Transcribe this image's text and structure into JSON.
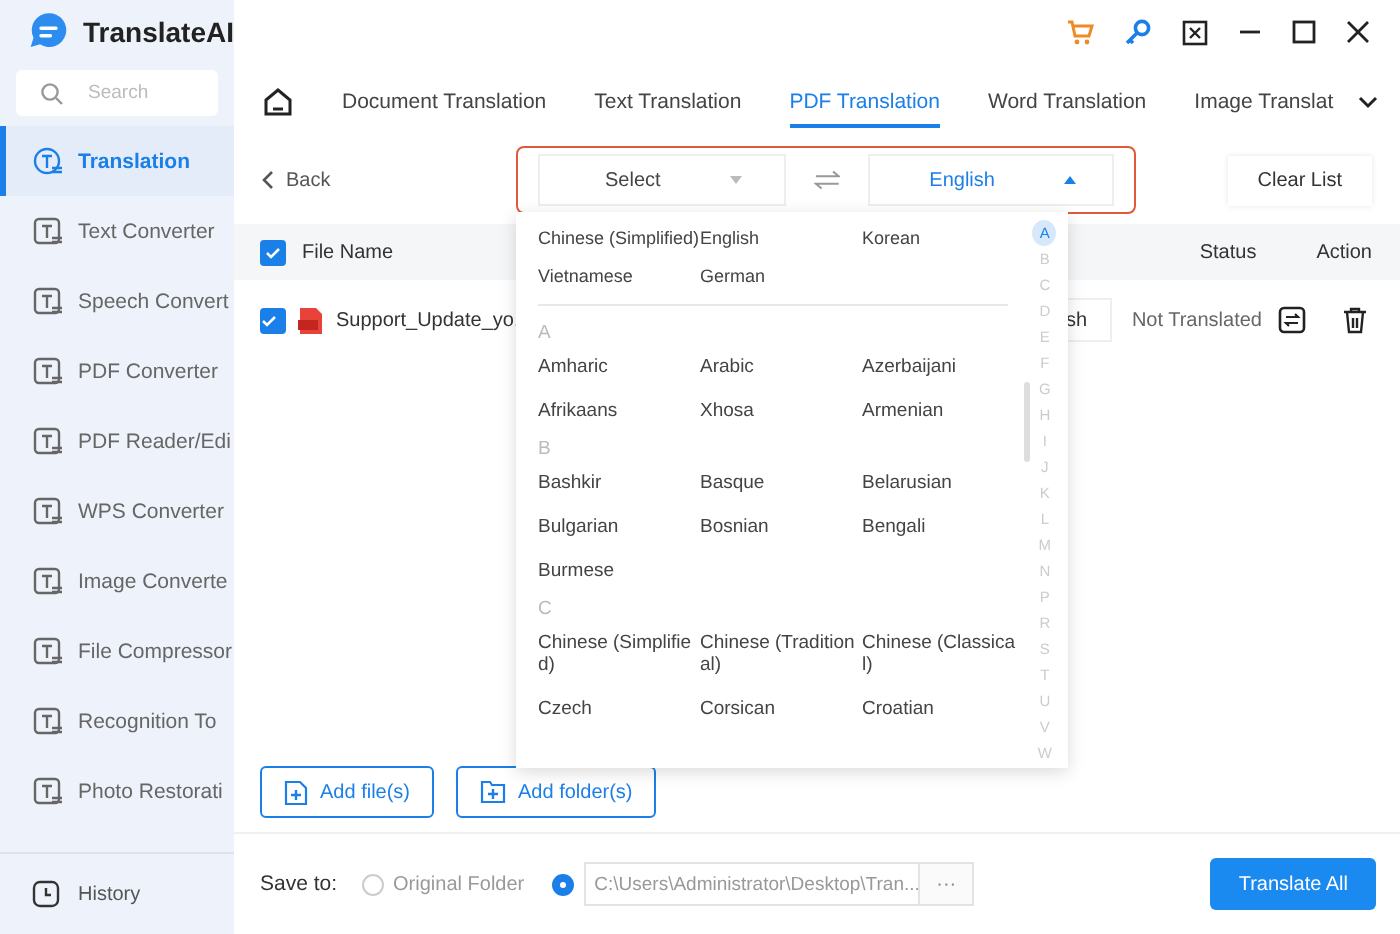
{
  "app": {
    "title": "TranslateAI"
  },
  "sidebar": {
    "search": {
      "placeholder": "Search"
    },
    "items": [
      {
        "label": "Translation",
        "selected": true
      },
      {
        "label": "Text Converter",
        "selected": false
      },
      {
        "label": "Speech Convert",
        "selected": false
      },
      {
        "label": "PDF Converter",
        "selected": false
      },
      {
        "label": "PDF Reader/Edi",
        "selected": false
      },
      {
        "label": "WPS Converter",
        "selected": false
      },
      {
        "label": "Image Converte",
        "selected": false
      },
      {
        "label": "File Compressor",
        "selected": false
      },
      {
        "label": "Recognition To",
        "selected": false
      },
      {
        "label": "Photo Restorati",
        "selected": false
      }
    ],
    "footer": {
      "label": "History"
    }
  },
  "tabs": [
    {
      "label": "Document Translation",
      "selected": false
    },
    {
      "label": "Text Translation",
      "selected": false
    },
    {
      "label": "PDF Translation",
      "selected": true
    },
    {
      "label": "Word Translation",
      "selected": false
    },
    {
      "label": "Image Translat",
      "selected": false
    }
  ],
  "toolbar": {
    "back": "Back",
    "source_language": "Select",
    "target_language": "English",
    "target_open": true,
    "clear": "Clear List"
  },
  "table": {
    "header_checked": true,
    "columns": [
      {
        "label": "File Name"
      },
      {
        "label": "Status"
      },
      {
        "label": "Action"
      }
    ],
    "rows": [
      {
        "checked": true,
        "file_name": "Support_Update_yo.",
        "target_language": "sh",
        "status": "Not Translated"
      }
    ]
  },
  "language_dropdown": {
    "recent": [
      "Chinese (Simplified)",
      "English",
      "Korean",
      "Vietnamese",
      "German"
    ],
    "groups": [
      {
        "letter": "A",
        "languages": [
          "Amharic",
          "Arabic",
          "Azerbaijani",
          "Afrikaans",
          "Xhosa",
          "Armenian"
        ]
      },
      {
        "letter": "B",
        "languages": [
          "Bashkir",
          "Basque",
          "Belarusian",
          "Bulgarian",
          "Bosnian",
          "Bengali",
          "Burmese"
        ]
      },
      {
        "letter": "C",
        "languages": [
          "Chinese (Simplified)",
          "Chinese (Traditional)",
          "Chinese (Classical)",
          "Czech",
          "Corsican",
          "Croatian"
        ]
      }
    ],
    "index": [
      {
        "letter": "A",
        "selected": true
      },
      {
        "letter": "B",
        "selected": false
      },
      {
        "letter": "C",
        "selected": false
      },
      {
        "letter": "D",
        "selected": false
      },
      {
        "letter": "E",
        "selected": false
      },
      {
        "letter": "F",
        "selected": false
      },
      {
        "letter": "G",
        "selected": false
      },
      {
        "letter": "H",
        "selected": false
      },
      {
        "letter": "I",
        "selected": false
      },
      {
        "letter": "J",
        "selected": false
      },
      {
        "letter": "K",
        "selected": false
      },
      {
        "letter": "L",
        "selected": false
      },
      {
        "letter": "M",
        "selected": false
      },
      {
        "letter": "N",
        "selected": false
      },
      {
        "letter": "P",
        "selected": false
      },
      {
        "letter": "R",
        "selected": false
      },
      {
        "letter": "S",
        "selected": false
      },
      {
        "letter": "T",
        "selected": false
      },
      {
        "letter": "U",
        "selected": false
      },
      {
        "letter": "V",
        "selected": false
      },
      {
        "letter": "W",
        "selected": false
      }
    ]
  },
  "actions": {
    "add_files": "Add file(s)",
    "add_folders": "Add folder(s)"
  },
  "save": {
    "label": "Save to:",
    "options": [
      {
        "kind": "original",
        "label": "Original Folder",
        "selected": false
      },
      {
        "kind": "custom",
        "path": "C:\\Users\\Administrator\\Desktop\\Tran...",
        "selected": true
      }
    ],
    "browse": "···",
    "translate": "Translate All"
  }
}
